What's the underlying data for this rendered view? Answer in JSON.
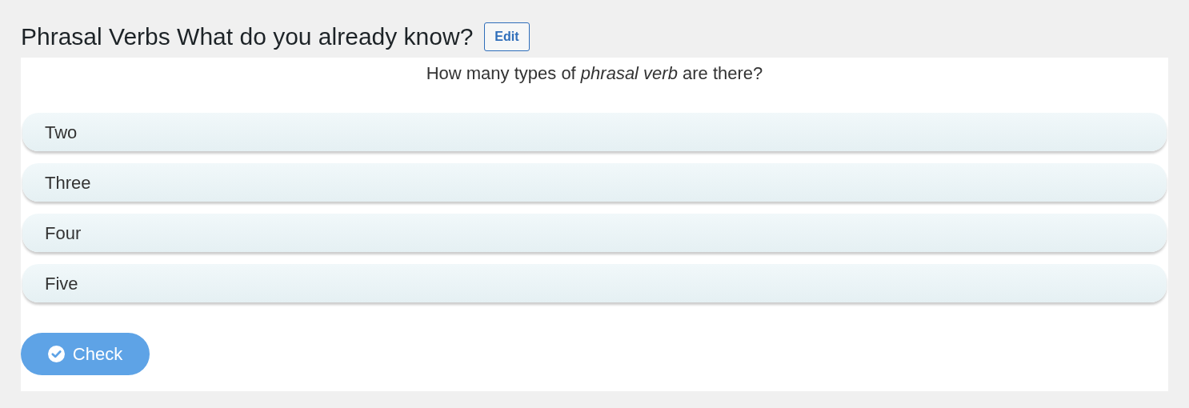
{
  "title": "Phrasal Verbs What do you already know?",
  "edit_button": "Edit",
  "question": "How many types of *phrasal verb* are there?",
  "options": [
    {
      "label": "Two",
      "selected": false
    },
    {
      "label": "Three",
      "selected": false
    },
    {
      "label": "Four",
      "selected": false
    },
    {
      "label": "Five",
      "selected": false
    }
  ],
  "check_button": "Check"
}
